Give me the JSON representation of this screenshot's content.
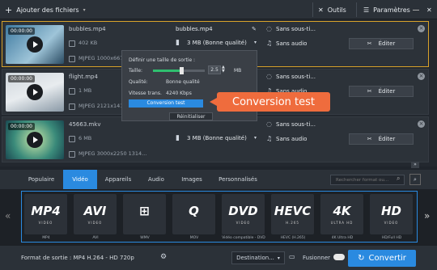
{
  "topbar": {
    "add_files": "Ajouter des fichiers",
    "tools": "Outils",
    "settings": "Paramètres"
  },
  "files": [
    {
      "timecode": "00:00:00",
      "name": "bubbles.mp4",
      "size": "402 KB",
      "meta": "MJPEG 1000x667...",
      "out_name": "bubbles.mp4",
      "out_size": "3 MB (Bonne qualité)",
      "subtitles": "Sans sous-ti...",
      "audio": "Sans audio",
      "edit": "Éditer"
    },
    {
      "timecode": "00:00:00",
      "name": "flight.mp4",
      "size": "1 MB",
      "meta": "MJPEG 2121x141...",
      "out_name": "",
      "out_size": "",
      "subtitles": "Sans sous-ti...",
      "audio": "Sans audio",
      "edit": "Éditer"
    },
    {
      "timecode": "00:00:00",
      "name": "45663.mkv",
      "size": "6 MB",
      "meta": "MJPEG 3000x2250 1314...",
      "out_name": "",
      "out_size": "3 MB (Bonne qualité)",
      "subtitles": "Sans sous-ti...",
      "audio": "Sans audio",
      "edit": "Éditer"
    }
  ],
  "popup": {
    "title": "Définir une taille de sortie :",
    "size_label": "Taille:",
    "size_value": "2.5",
    "size_unit": "MB",
    "quality_label": "Qualité:",
    "quality_value": "Bonne qualité",
    "bitrate_label": "Vitesse trans.",
    "bitrate_value": "4240 Kbps",
    "test_button": "Conversion test",
    "reset_button": "Réinitialiser",
    "slider_fraction": 0.55
  },
  "callout": "Conversion test",
  "tabs": [
    "Populaire",
    "Vidéo",
    "Appareils",
    "Audio",
    "Images",
    "Personnalisés"
  ],
  "active_tab": "Vidéo",
  "search": {
    "placeholder": "Rechercher format ou..."
  },
  "formats": [
    {
      "big": "MP4",
      "small": "VIDEO",
      "label": "MP4"
    },
    {
      "big": "AVI",
      "small": "VIDEO",
      "label": "AVI"
    },
    {
      "big": "⊞",
      "small": "",
      "label": "WMV"
    },
    {
      "big": "Q",
      "small": "",
      "label": "MOV"
    },
    {
      "big": "DVD",
      "small": "VIDEO",
      "label": "Vidéo compatible - DVD"
    },
    {
      "big": "HEVC",
      "small": "H.265",
      "label": "HEVC (H.265)"
    },
    {
      "big": "4K",
      "small": "ULTRA HD",
      "label": "4K Ultra HD"
    },
    {
      "big": "HD",
      "small": "VIDEO",
      "label": "HD/Full HD"
    }
  ],
  "bottom": {
    "format_label": "Format de sortie : MP4 H.264 - HD 720p",
    "destination": "Destination...",
    "merge": "Fusionner",
    "convert": "Convertir"
  },
  "colors": {
    "accent": "#2a8ae0",
    "callout": "#ef6c3d",
    "selection": "#d8a22a"
  }
}
